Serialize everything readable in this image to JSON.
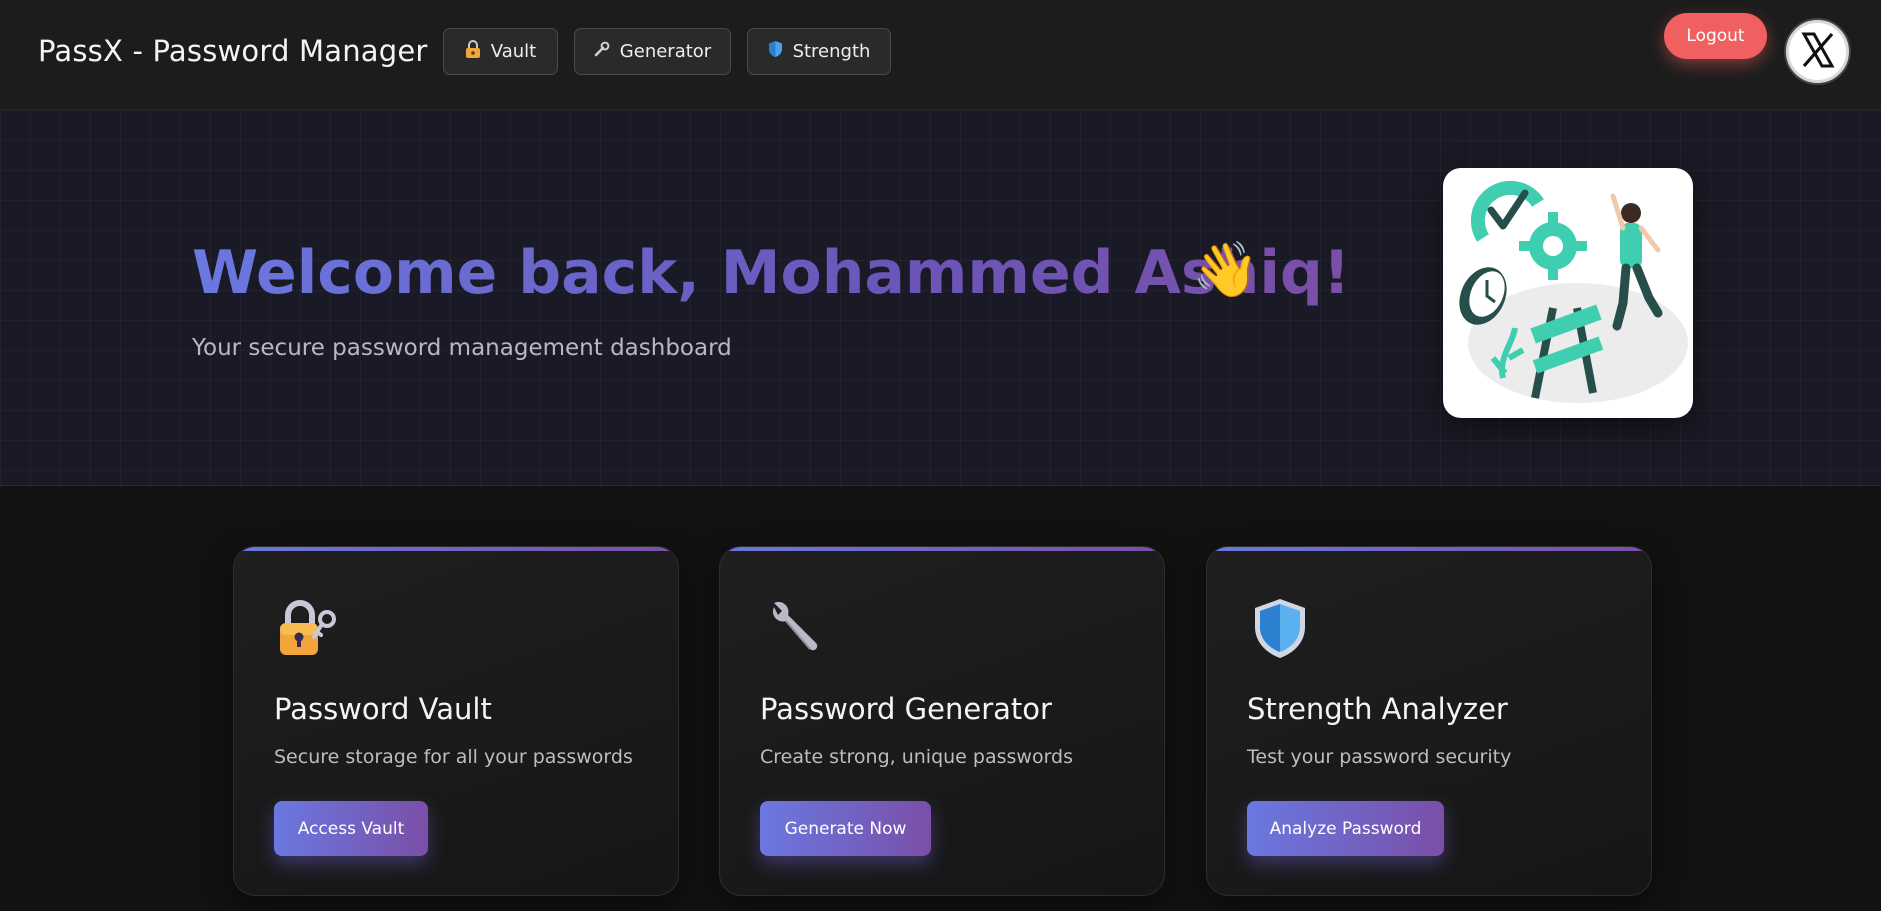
{
  "header": {
    "brand": "PassX - Password Manager",
    "nav": [
      {
        "label": "Vault",
        "icon": "lock-icon"
      },
      {
        "label": "Generator",
        "icon": "wrench-icon"
      },
      {
        "label": "Strength",
        "icon": "shield-icon"
      }
    ],
    "logout_label": "Logout",
    "avatar_icon": "x-logo-icon"
  },
  "hero": {
    "title": "Welcome back, Mohammed Ashiq!",
    "wave": "👋",
    "subtitle": "Your secure password management dashboard",
    "illustration": "work-in-progress-illustration"
  },
  "cards": [
    {
      "icon": "lock-key-icon",
      "title": "Password Vault",
      "description": "Secure storage for all your passwords",
      "button": "Access Vault"
    },
    {
      "icon": "wrench-icon",
      "title": "Password Generator",
      "description": "Create strong, unique passwords",
      "button": "Generate Now"
    },
    {
      "icon": "shield-icon",
      "title": "Strength Analyzer",
      "description": "Test your password security",
      "button": "Analyze Password"
    }
  ],
  "colors": {
    "accent_start": "#6a78e0",
    "accent_end": "#7a4fa8",
    "logout": "#f06060",
    "background": "#121212"
  }
}
